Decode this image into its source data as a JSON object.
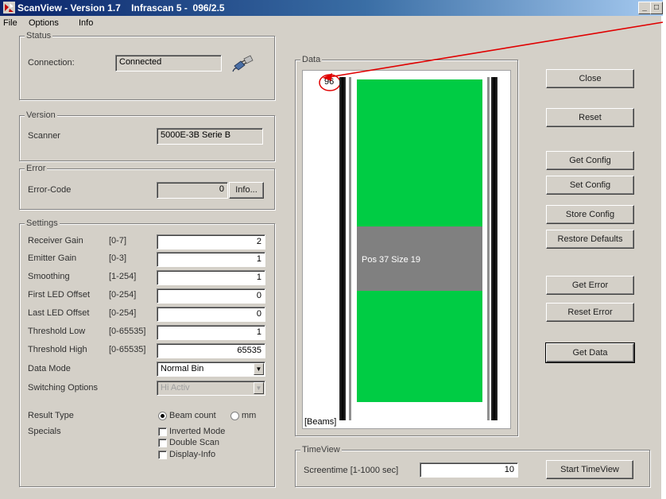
{
  "window": {
    "title": "ScanView - Version 1.7    Infrascan 5 -  096/2.5"
  },
  "menu": [
    "File",
    "Options",
    "Info"
  ],
  "status": {
    "group": "Status",
    "connection_label": "Connection:",
    "connection_value": "Connected"
  },
  "version": {
    "group": "Version",
    "scanner_label": "Scanner",
    "scanner_value": "5000E-3B Serie B"
  },
  "error": {
    "group": "Error",
    "code_label": "Error-Code",
    "code_value": "0",
    "info_button": "Info..."
  },
  "settings": {
    "group": "Settings",
    "rows": [
      {
        "label": "Receiver Gain",
        "range": "[0-7]",
        "value": "2"
      },
      {
        "label": "Emitter Gain",
        "range": "[0-3]",
        "value": "1"
      },
      {
        "label": "Smoothing",
        "range": "[1-254]",
        "value": "1"
      },
      {
        "label": "First LED Offset",
        "range": "[0-254]",
        "value": "0"
      },
      {
        "label": "Last LED Offset",
        "range": "[0-254]",
        "value": "0"
      },
      {
        "label": "Threshold Low",
        "range": "[0-65535]",
        "value": "1"
      },
      {
        "label": "Threshold High",
        "range": "[0-65535]",
        "value": "65535"
      }
    ],
    "data_mode_label": "Data Mode",
    "data_mode_value": "Normal Bin",
    "switching_label": "Switching Options",
    "switching_value": "Hi Activ",
    "result_type_label": "Result Type",
    "result_options": [
      "Beam count",
      "mm"
    ],
    "result_selected": "Beam count",
    "specials_label": "Specials",
    "specials": [
      {
        "label": "Inverted Mode",
        "checked": false
      },
      {
        "label": "Double Scan",
        "checked": false
      },
      {
        "label": "Display-Info",
        "checked": false
      }
    ]
  },
  "data": {
    "group": "Data",
    "beams_max": "96",
    "beams_label": "[Beams]",
    "segment_text": "Pos 37 Size 19",
    "bar_colors": {
      "active": "#00cc44",
      "segment": "#808080"
    }
  },
  "buttons": {
    "close": "Close",
    "reset": "Reset",
    "get_config": "Get Config",
    "set_config": "Set Config",
    "store_config": "Store Config",
    "restore_defaults": "Restore Defaults",
    "get_error": "Get Error",
    "reset_error": "Reset Error",
    "get_data": "Get Data"
  },
  "timeview": {
    "group": "TimeView",
    "screentime_label": "Screentime [1-1000 sec]",
    "screentime_value": "10",
    "start_button": "Start TimeView"
  }
}
